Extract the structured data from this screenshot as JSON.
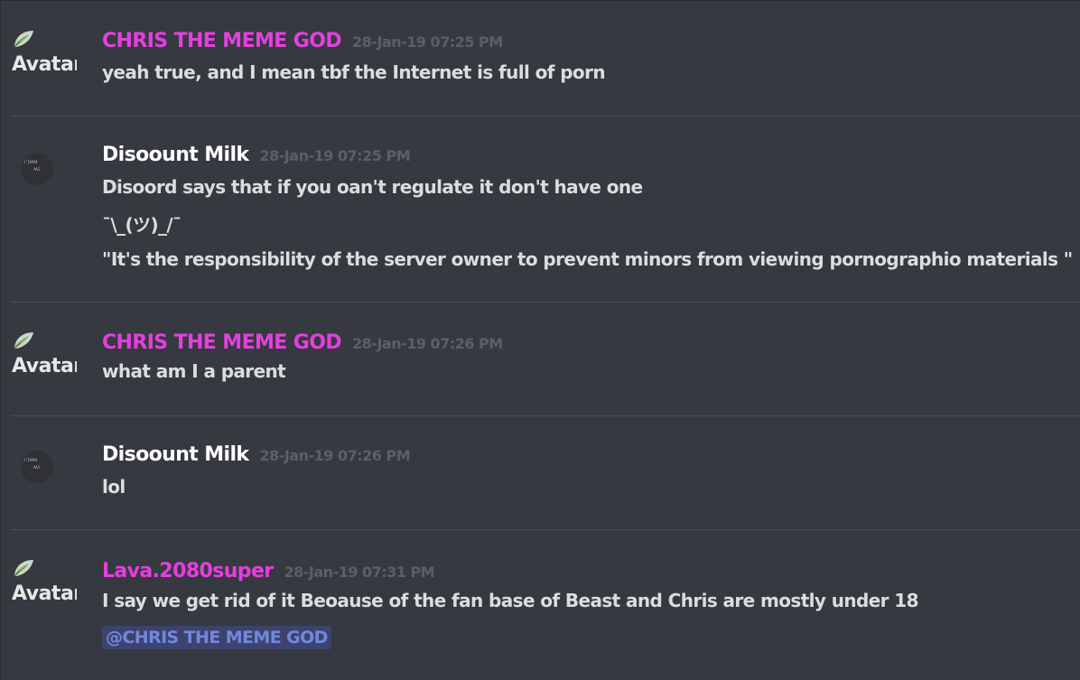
{
  "colors": {
    "background": "#36393f",
    "username_magenta": "#e53fe0",
    "username_white": "#ffffff",
    "timestamp": "#5c5f66",
    "message_text": "#dcddde",
    "mention_bg": "#3d4270",
    "mention_text": "#7289da",
    "divider": "#4a4d54"
  },
  "avatar_alt_text": "Avatar",
  "messages": [
    {
      "username": "CHRIS THE MEME GOD",
      "timestamp": "28-Jan-19 07:25 PM",
      "avatar": "broken-image-avatar",
      "lines": [
        "yeah true, and I mean tbf the Internet is full of porn"
      ]
    },
    {
      "username": "Disoount Milk",
      "timestamp": "28-Jan-19 07:25 PM",
      "avatar": "milk-avatar",
      "lines": [
        "Disoord says that if  you oan't regulate it don't have one",
        "¯\\_(ツ)_/¯",
        "\"It's the responsibility of the server owner to prevent minors from viewing pornographio materials \""
      ]
    },
    {
      "username": "CHRIS THE MEME GOD",
      "timestamp": "28-Jan-19 07:26 PM",
      "avatar": "broken-image-avatar",
      "lines": [
        "what am I a parent"
      ]
    },
    {
      "username": "Disoount Milk",
      "timestamp": "28-Jan-19 07:26 PM",
      "avatar": "milk-avatar",
      "lines": [
        "lol"
      ]
    },
    {
      "username": "Lava.2080super",
      "timestamp": "28-Jan-19 07:31 PM",
      "avatar": "broken-image-avatar",
      "lines": [
        " I say we get rid of it Beoause of the fan base of Beast and Chris are mostly under 18"
      ],
      "mention": "@CHRIS THE MEME GOD"
    }
  ]
}
